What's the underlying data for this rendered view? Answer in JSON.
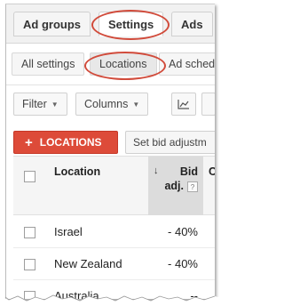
{
  "tabs": [
    {
      "label": "Ad groups"
    },
    {
      "label": "Settings"
    },
    {
      "label": "Ads"
    }
  ],
  "subtabs": [
    {
      "label": "All settings"
    },
    {
      "label": "Locations"
    },
    {
      "label": "Ad sched"
    }
  ],
  "toolbar": {
    "filter_label": "Filter",
    "columns_label": "Columns"
  },
  "actions": {
    "add_label": "LOCATIONS",
    "bid_label": "Set bid adjustm"
  },
  "table": {
    "headers": {
      "location": "Location",
      "bid_line1": "Bid",
      "bid_line2": "adj.",
      "help": "?",
      "next": "C"
    },
    "rows": [
      {
        "location": "Israel",
        "bid": "- 40%"
      },
      {
        "location": "New Zealand",
        "bid": "- 40%"
      },
      {
        "location": "Australia",
        "bid": "--"
      }
    ]
  },
  "colors": {
    "accent_red": "#dd4b39",
    "highlight_oval": "#d14b3b"
  }
}
